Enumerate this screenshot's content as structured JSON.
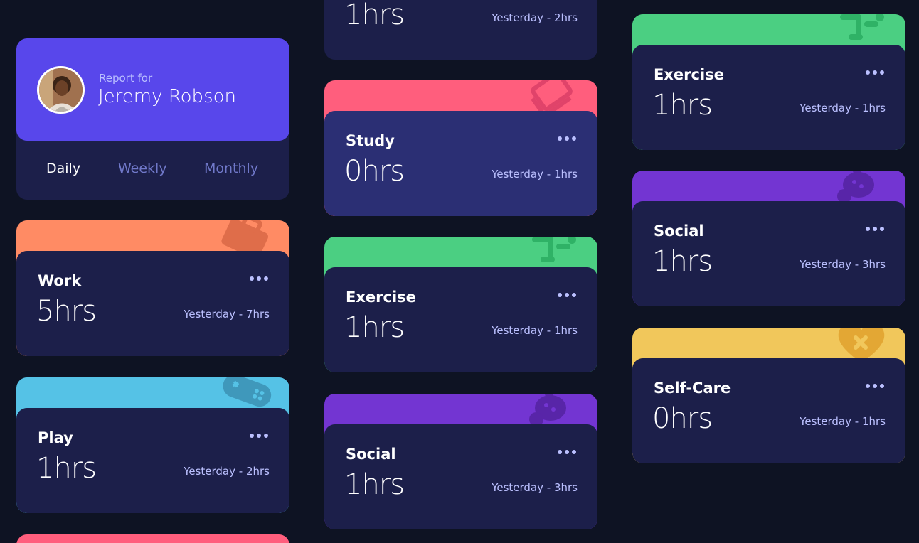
{
  "profile": {
    "report_for": "Report for",
    "name": "Jeremy Robson"
  },
  "periods": [
    "Daily",
    "Weekly",
    "Monthly"
  ],
  "active_period": "Daily",
  "colors": {
    "background": "#0e1323",
    "card": "#1c1f4a",
    "card_highlight": "#2b2f74",
    "profile_accent": "#5847eb",
    "muted_text": "#bbc0ff",
    "work": "#ff8b64",
    "play": "#55c2e6",
    "study": "#ff5e7d",
    "exercise": "#4bcf82",
    "social": "#7335d2",
    "self_care": "#f1c75b"
  },
  "cards": {
    "work": {
      "title": "Work",
      "hours": "5hrs",
      "previous": "Yesterday - 7hrs",
      "icon": "briefcase-icon"
    },
    "play": {
      "title": "Play",
      "hours": "1hrs",
      "previous": "Yesterday - 2hrs",
      "icon": "gamepad-icon"
    },
    "col2_top": {
      "hours": "1hrs",
      "previous": "Yesterday - 2hrs"
    },
    "study": {
      "title": "Study",
      "hours": "0hrs",
      "previous": "Yesterday - 1hrs",
      "icon": "book-icon"
    },
    "exercise": {
      "title": "Exercise",
      "hours": "1hrs",
      "previous": "Yesterday - 1hrs",
      "icon": "running-icon"
    },
    "social": {
      "title": "Social",
      "hours": "1hrs",
      "previous": "Yesterday - 3hrs",
      "icon": "social-icon"
    },
    "exercise2": {
      "title": "Exercise",
      "hours": "1hrs",
      "previous": "Yesterday - 1hrs",
      "icon": "running-icon"
    },
    "social2": {
      "title": "Social",
      "hours": "1hrs",
      "previous": "Yesterday - 3hrs",
      "icon": "social-icon"
    },
    "self_care": {
      "title": "Self-Care",
      "hours": "0hrs",
      "previous": "Yesterday - 1hrs",
      "icon": "heart-icon"
    }
  }
}
